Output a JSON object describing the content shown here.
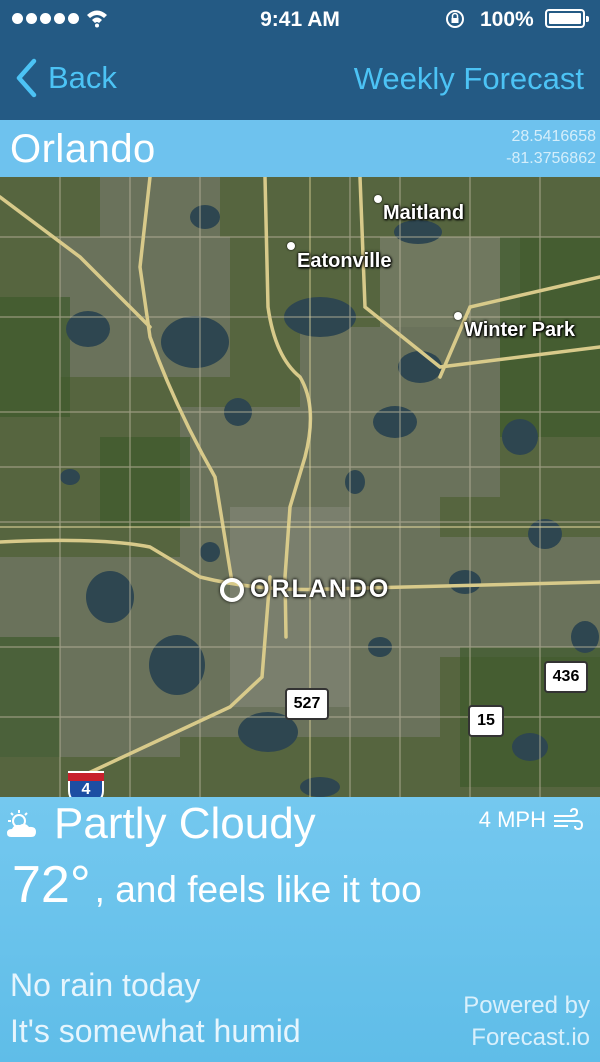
{
  "status_bar": {
    "time": "9:41 AM",
    "battery": "100%",
    "icons": [
      "signal-dots-icon",
      "wifi-icon",
      "rotation-lock-icon",
      "battery-icon"
    ]
  },
  "nav": {
    "back_label": "Back",
    "back_icon": "chevron-left-icon",
    "weekly_label": "Weekly Forecast",
    "accent": "#4cc3f5"
  },
  "location": {
    "city": "Orlando",
    "latitude": "28.5416658",
    "longitude": "-81.3756862"
  },
  "map": {
    "labels": {
      "maitland": "Maitland",
      "eatonville": "Eatonville",
      "winter_park": "Winter Park",
      "orlando": "ORLANDO"
    },
    "shields": {
      "r527": "527",
      "r436": "436",
      "r15": "15",
      "i4": "4"
    }
  },
  "weather": {
    "condition": "Partly Cloudy",
    "condition_icon": "partly-cloudy-icon",
    "wind": "4 MPH",
    "wind_icon": "wind-icon",
    "temperature": "72°",
    "feels_like": ", and feels like it too",
    "rain": "No rain today",
    "humidity": "It's somewhat humid",
    "powered_line1": "Powered by",
    "powered_line2": "Forecast.io",
    "panel_color": "#6ec2ee"
  }
}
